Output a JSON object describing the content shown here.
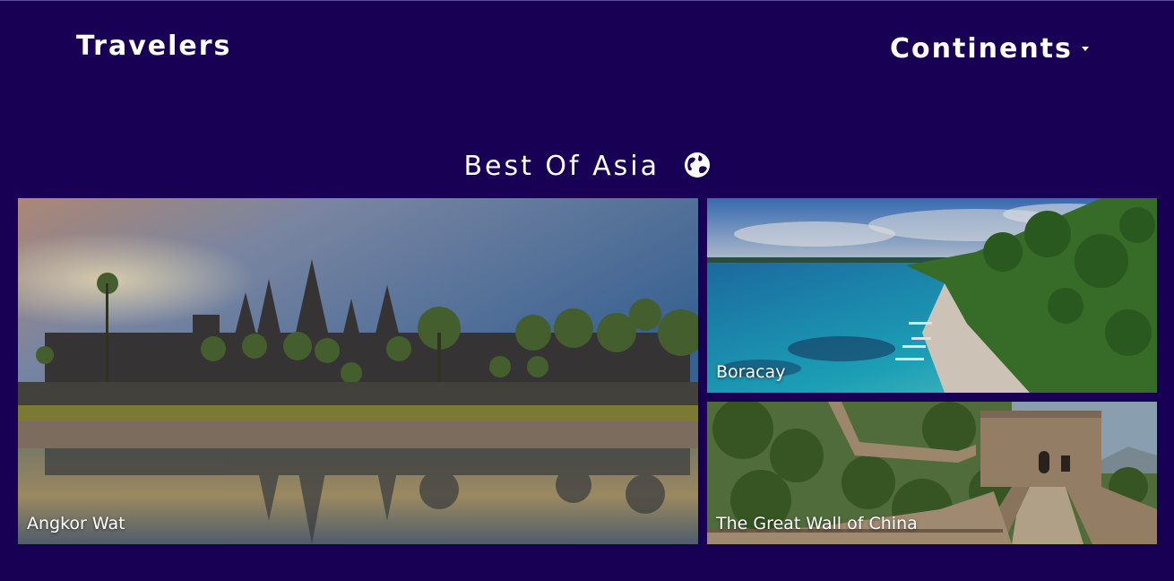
{
  "nav": {
    "brand": "Travelers",
    "continents_label": "Continents"
  },
  "section": {
    "title": "Best Of Asia",
    "icon": "globe-icon"
  },
  "destinations": [
    {
      "name": "Angkor Wat"
    },
    {
      "name": "Boracay"
    },
    {
      "name": "The Great Wall of China"
    }
  ],
  "colors": {
    "background": "#180054",
    "text": "#ffffff"
  }
}
